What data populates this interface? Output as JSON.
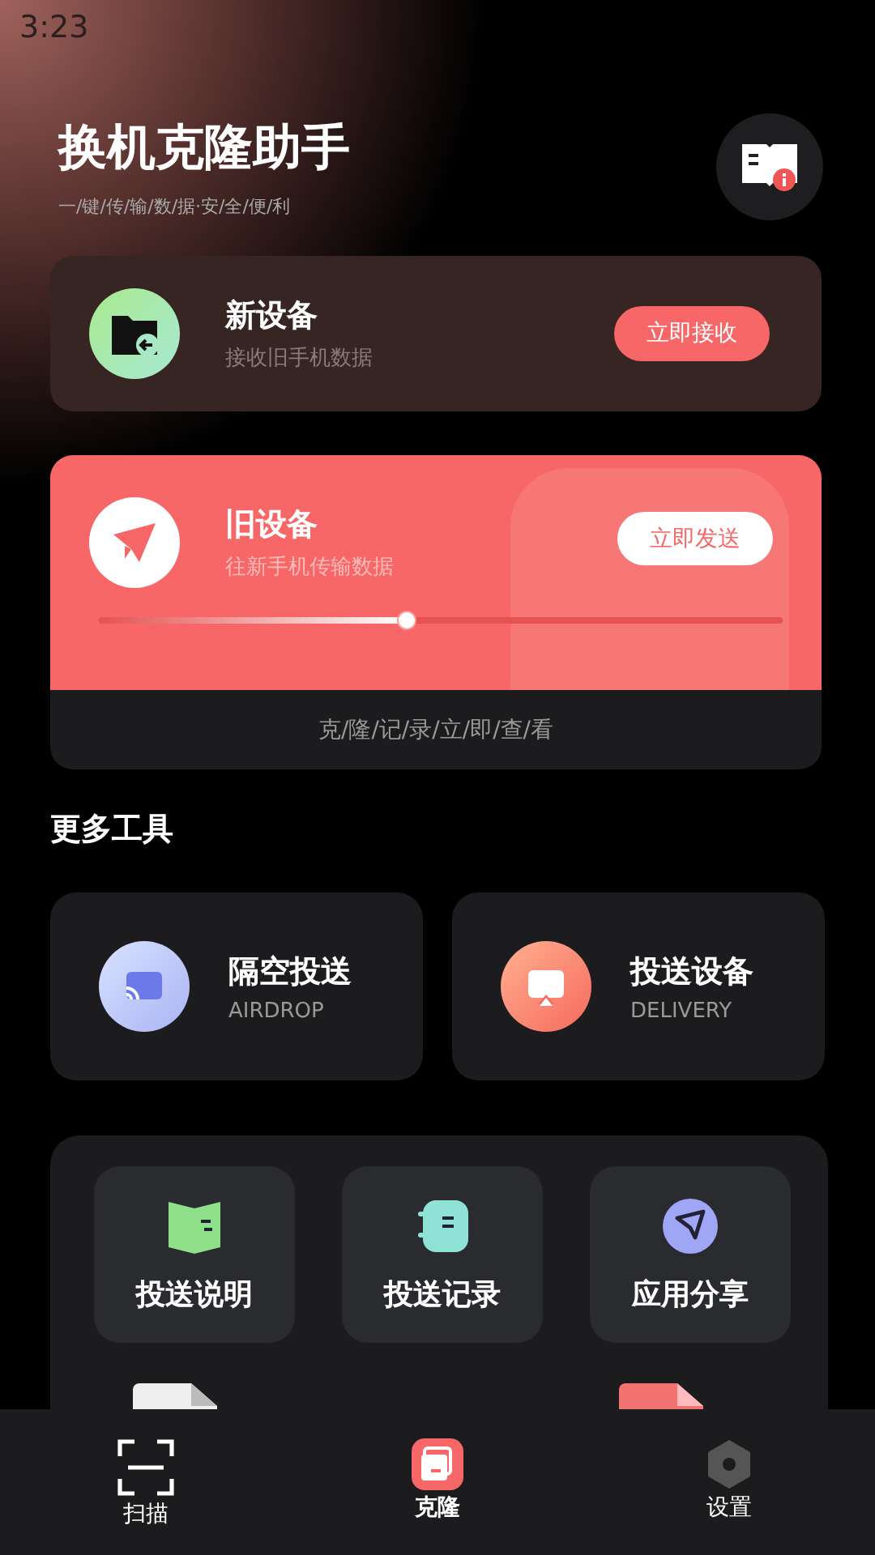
{
  "status_bar": {
    "time": "3:23"
  },
  "header": {
    "title": "换机克隆助手",
    "subtitle": "一/键/传/输/数/据·安/全/便/利"
  },
  "new_device": {
    "title": "新设备",
    "subtitle": "接收旧手机数据",
    "button": "立即接收"
  },
  "old_device": {
    "title": "旧设备",
    "subtitle": "往新手机传输数据",
    "button": "立即发送",
    "level": 0.45,
    "footer": "克/隆/记/录/立/即/查/看"
  },
  "more_tools": {
    "heading": "更多工具",
    "cards": [
      {
        "kind": "cast",
        "title": "隔空投送",
        "subtitle": "AIRDROP"
      },
      {
        "kind": "device",
        "title": "投送设备",
        "subtitle": "DELIVERY"
      }
    ]
  },
  "tools_grid": [
    {
      "kind": "guide",
      "label": "投送说明"
    },
    {
      "kind": "record",
      "label": "投送记录"
    },
    {
      "kind": "share",
      "label": "应用分享"
    }
  ],
  "bottom_nav": [
    {
      "kind": "scan",
      "label": "扫描",
      "selected": false
    },
    {
      "kind": "clone",
      "label": "克隆",
      "selected": true
    },
    {
      "kind": "settings",
      "label": "设置",
      "selected": false
    }
  ]
}
